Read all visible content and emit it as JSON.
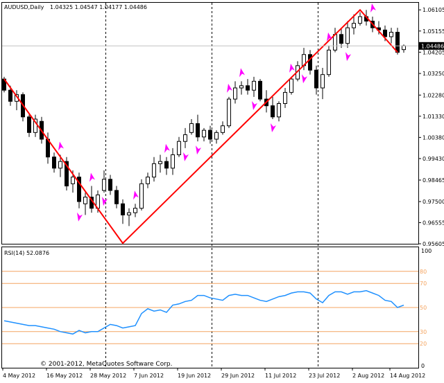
{
  "price_chart": {
    "symbol_label": "AUDUSD,Daily",
    "ohlc_label": "1.04325 1.04547 1.04177 1.04486",
    "current_price": 1.04486,
    "current_price_label": "1.04486",
    "y_ticks": [
      {
        "value": 1.06105,
        "label": "1.06105"
      },
      {
        "value": 1.05155,
        "label": "1.05155"
      },
      {
        "value": 1.04205,
        "label": "1.04205"
      },
      {
        "value": 1.0325,
        "label": "1.03250"
      },
      {
        "value": 1.0228,
        "label": "1.02280"
      },
      {
        "value": 1.0133,
        "label": "1.01330"
      },
      {
        "value": 1.0038,
        "label": "1.00380"
      },
      {
        "value": 0.9943,
        "label": "0.99430"
      },
      {
        "value": 0.98465,
        "label": "0.98465"
      },
      {
        "value": 0.975,
        "label": "0.97500"
      },
      {
        "value": 0.96555,
        "label": "0.96555"
      },
      {
        "value": 0.95605,
        "label": "0.95605"
      }
    ],
    "ylim": [
      0.95605,
      1.06423
    ]
  },
  "rsi_panel": {
    "indicator_label": "RSI(14) 52.0876",
    "levels": [
      {
        "value": 80,
        "label": "80"
      },
      {
        "value": 70,
        "label": "70"
      },
      {
        "value": 50,
        "label": "50"
      },
      {
        "value": 30,
        "label": "30"
      },
      {
        "value": 20,
        "label": "20"
      }
    ],
    "y_ticks": [
      {
        "value": 100,
        "label": "100"
      },
      {
        "value": 0,
        "label": "0"
      }
    ]
  },
  "x_axis": {
    "labels": [
      "4 May 2012",
      "16 May 2012",
      "28 May 2012",
      "7 Jun 2012",
      "19 Jun 2012",
      "29 Jun 2012",
      "11 Jul 2012",
      "23 Jul 2012",
      "2 Aug 2012",
      "14 Aug 2012"
    ]
  },
  "copyright": "© 2001-2012, MetaQuotes Software Corp.",
  "colors": {
    "bull_candle": "#ffffff",
    "bear_candle": "#000000",
    "zigzag": "#ff0000",
    "fractal_arrows": "#ff00ff",
    "rsi_line": "#1e90ff",
    "rsi_levels": "#f4a460",
    "current_price_line": "#c0c0c0"
  },
  "chart_data": {
    "type": "candlestick",
    "series": [
      {
        "name": "",
        "candles": [
          [
            1.03,
            1.031,
            1.024,
            1.025
          ],
          [
            1.025,
            1.027,
            1.018,
            1.02
          ],
          [
            1.02,
            1.025,
            1.016,
            1.023
          ],
          [
            1.023,
            1.024,
            1.011,
            1.013
          ],
          [
            1.013,
            1.014,
            1.004,
            1.006
          ],
          [
            1.006,
            1.014,
            1.004,
            1.012
          ],
          [
            1.011,
            1.013,
            1.001,
            1.003
          ],
          [
            1.003,
            1.006,
            0.992,
            0.995
          ],
          [
            0.995,
            0.997,
            0.988,
            0.99
          ],
          [
            0.99,
            0.996,
            0.986,
            0.993
          ],
          [
            0.993,
            0.995,
            0.98,
            0.982
          ],
          [
            0.983,
            0.989,
            0.979,
            0.986
          ],
          [
            0.986,
            0.988,
            0.972,
            0.975
          ],
          [
            0.974,
            0.979,
            0.969,
            0.977
          ],
          [
            0.977,
            0.982,
            0.97,
            0.972
          ],
          [
            0.972,
            0.98,
            0.97,
            0.978
          ],
          [
            0.98,
            0.989,
            0.979,
            0.985
          ],
          [
            0.985,
            0.987,
            0.978,
            0.98
          ],
          [
            0.98,
            0.982,
            0.972,
            0.974
          ],
          [
            0.974,
            0.976,
            0.965,
            0.969
          ],
          [
            0.969,
            0.972,
            0.964,
            0.97
          ],
          [
            0.97,
            0.974,
            0.968,
            0.972
          ],
          [
            0.972,
            0.985,
            0.971,
            0.983
          ],
          [
            0.983,
            0.988,
            0.981,
            0.986
          ],
          [
            0.986,
            0.995,
            0.984,
            0.992
          ],
          [
            0.992,
            0.996,
            0.988,
            0.993
          ],
          [
            0.993,
            0.995,
            0.987,
            0.99
          ],
          [
            0.99,
            0.999,
            0.987,
            0.996
          ],
          [
            0.996,
            1.004,
            0.995,
            1.002
          ],
          [
            1.002,
            1.008,
            0.999,
            1.005
          ],
          [
            1.006,
            1.012,
            1.005,
            1.01
          ],
          [
            1.01,
            1.014,
            1.002,
            1.004
          ],
          [
            1.004,
            1.008,
            1.002,
            1.007
          ],
          [
            1.007,
            1.009,
            1.001,
            1.003
          ],
          [
            1.003,
            1.007,
            1.001,
            1.006
          ],
          [
            1.006,
            1.011,
            1.005,
            1.009
          ],
          [
            1.009,
            1.022,
            1.008,
            1.021
          ],
          [
            1.021,
            1.029,
            1.019,
            1.026
          ],
          [
            1.026,
            1.029,
            1.023,
            1.027
          ],
          [
            1.027,
            1.03,
            1.023,
            1.025
          ],
          [
            1.025,
            1.031,
            1.022,
            1.029
          ],
          [
            1.029,
            1.03,
            1.02,
            1.021
          ],
          [
            1.021,
            1.025,
            1.015,
            1.018
          ],
          [
            1.018,
            1.022,
            1.012,
            1.013
          ],
          [
            1.013,
            1.02,
            1.011,
            1.019
          ],
          [
            1.019,
            1.026,
            1.017,
            1.024
          ],
          [
            1.024,
            1.031,
            1.023,
            1.03
          ],
          [
            1.03,
            1.038,
            1.029,
            1.036
          ],
          [
            1.036,
            1.044,
            1.034,
            1.041
          ],
          [
            1.041,
            1.043,
            1.032,
            1.034
          ],
          [
            1.034,
            1.036,
            1.023,
            1.026
          ],
          [
            1.026,
            1.035,
            1.021,
            1.032
          ],
          [
            1.032,
            1.045,
            1.031,
            1.043
          ],
          [
            1.043,
            1.053,
            1.042,
            1.05
          ],
          [
            1.05,
            1.053,
            1.044,
            1.046
          ],
          [
            1.046,
            1.056,
            1.044,
            1.053
          ],
          [
            1.053,
            1.059,
            1.05,
            1.055
          ],
          [
            1.055,
            1.06,
            1.054,
            1.058
          ],
          [
            1.058,
            1.061,
            1.054,
            1.056
          ],
          [
            1.056,
            1.058,
            1.051,
            1.053
          ],
          [
            1.053,
            1.056,
            1.05,
            1.052
          ],
          [
            1.052,
            1.054,
            1.047,
            1.049
          ],
          [
            1.049,
            1.053,
            1.046,
            1.051
          ],
          [
            1.051,
            1.053,
            1.041,
            1.042
          ],
          [
            1.0432,
            1.0455,
            1.0418,
            1.0449
          ]
        ]
      },
      {
        "name": "",
        "values": [
          39,
          38,
          37,
          36,
          35,
          35,
          34,
          33,
          32,
          30,
          29,
          28,
          31,
          29,
          30,
          30,
          33,
          36,
          35,
          33,
          34,
          35,
          45,
          49,
          47,
          48,
          46,
          52,
          53,
          55,
          56,
          60,
          60,
          58,
          57,
          56,
          60,
          61,
          60,
          60,
          58,
          56,
          55,
          57,
          59,
          60,
          62,
          63,
          63,
          62,
          57,
          54,
          60,
          63,
          63,
          61,
          63,
          63,
          64,
          62,
          60,
          56,
          55,
          50,
          52
        ]
      }
    ],
    "zigzag": [
      [
        0,
        1.03
      ],
      [
        19,
        0.9563
      ],
      [
        57,
        1.061
      ],
      [
        63,
        1.042
      ]
    ],
    "levels": [
      80,
      70,
      50,
      30,
      20
    ]
  }
}
